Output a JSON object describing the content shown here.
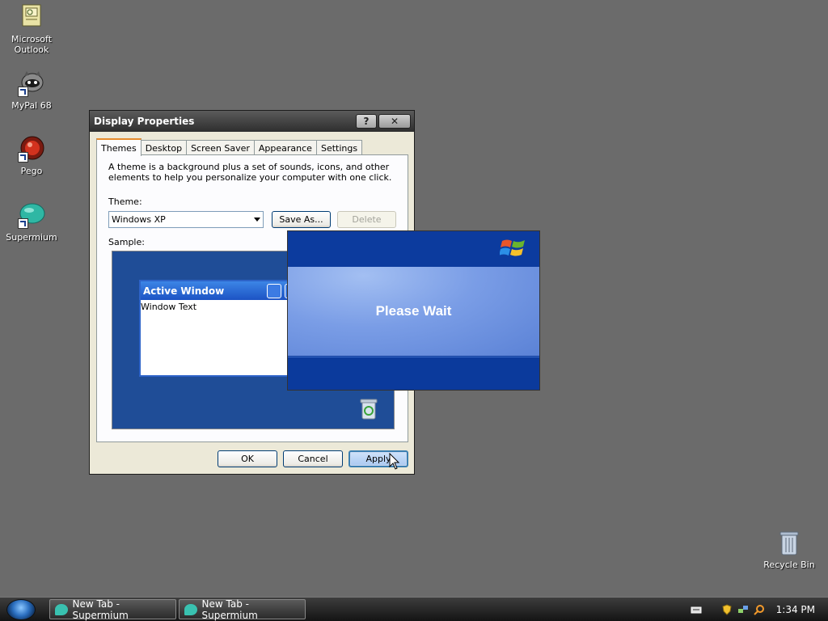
{
  "desktop": {
    "icons": [
      {
        "label_line1": "Microsoft",
        "label_line2": "Outlook",
        "icon": "outlook-icon"
      },
      {
        "label_line1": "MyPal 68",
        "label_line2": "",
        "icon": "mypal-icon"
      },
      {
        "label_line1": "Pego",
        "label_line2": "",
        "icon": "pego-icon"
      },
      {
        "label_line1": "Supermium",
        "label_line2": "",
        "icon": "supermium-icon"
      }
    ],
    "recycle_bin": "Recycle Bin"
  },
  "dialog": {
    "title": "Display Properties",
    "help_glyph": "?",
    "close_glyph": "✕",
    "tabs": [
      {
        "label": "Themes",
        "active": true
      },
      {
        "label": "Desktop",
        "active": false
      },
      {
        "label": "Screen Saver",
        "active": false
      },
      {
        "label": "Appearance",
        "active": false
      },
      {
        "label": "Settings",
        "active": false
      }
    ],
    "description": "A theme is a background plus a set of sounds, icons, and other elements to help you personalize your computer with one click.",
    "theme_label": "Theme:",
    "theme_value": "Windows XP",
    "save_as_label": "Save As...",
    "delete_label": "Delete",
    "sample_label": "Sample:",
    "sample": {
      "active_window_title": "Active Window",
      "window_text": "Window Text"
    },
    "ok_label": "OK",
    "cancel_label": "Cancel",
    "apply_label": "Apply"
  },
  "wait_popup": {
    "message": "Please Wait"
  },
  "taskbar": {
    "tasks": [
      {
        "label": "New Tab - Supermium"
      },
      {
        "label": "New Tab - Supermium"
      }
    ],
    "clock": "1:34 PM"
  },
  "colors": {
    "desktop_bg": "#6b6b6b",
    "xp_blue": "#0e3a9a",
    "accent_tab": "#e68b2c"
  }
}
